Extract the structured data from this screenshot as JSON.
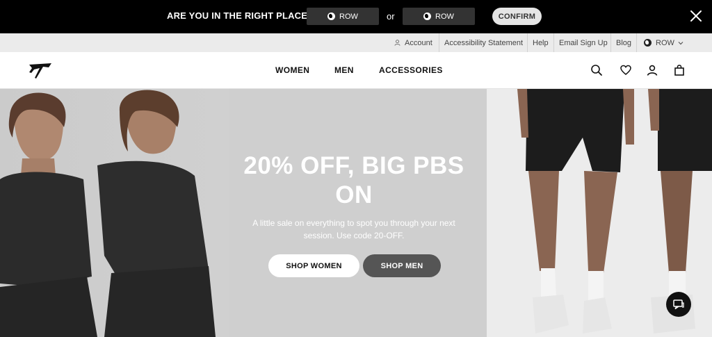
{
  "region_banner": {
    "question": "ARE YOU IN THE RIGHT PLACE?",
    "option_one": "ROW",
    "or_text": "or",
    "option_two": "ROW",
    "confirm_label": "CONFIRM"
  },
  "utility_nav": {
    "account": "Account",
    "accessibility": "Accessibility Statement",
    "help": "Help",
    "email_signup": "Email Sign Up",
    "blog": "Blog",
    "region": "ROW"
  },
  "main_nav": {
    "links": [
      "WOMEN",
      "MEN",
      "ACCESSORIES"
    ]
  },
  "hero": {
    "headline_line1": "20% OFF, BIG PBS",
    "headline_line2": "ON",
    "subtext_line1": "A little sale on everything to spot you through your next",
    "subtext_line2": "session. Use code 20-OFF.",
    "cta_women": "SHOP WOMEN",
    "cta_men": "SHOP MEN"
  },
  "colors": {
    "banner_bg": "#000000",
    "utility_bg": "#ebebeb",
    "hero_bg": "#cfcfcf",
    "cta_men_bg": "#555555"
  }
}
